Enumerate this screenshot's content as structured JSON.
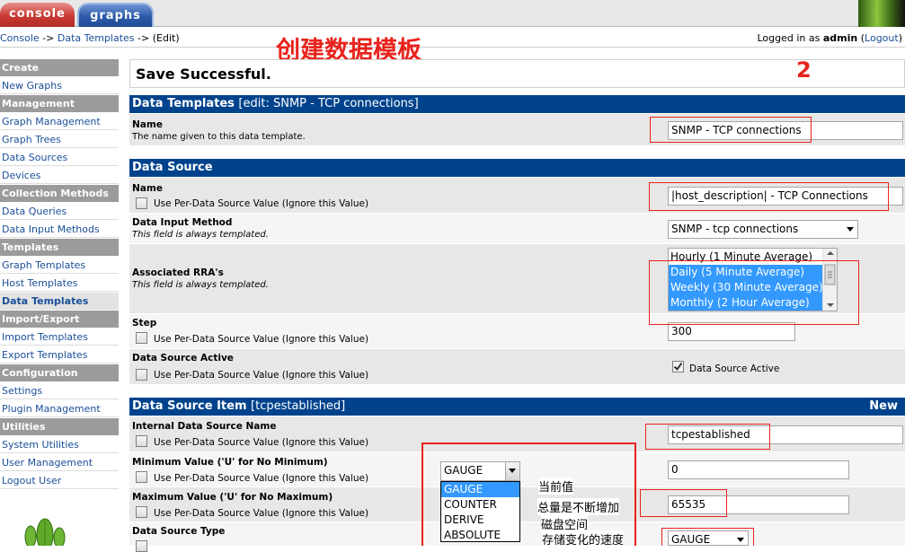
{
  "tabs": {
    "console": "console",
    "graphs": "graphs"
  },
  "breadcrumb": {
    "console": "Console",
    "sep1": "->",
    "data_templates": "Data Templates",
    "sep2": "->",
    "edit": "(Edit)"
  },
  "login": {
    "prefix": "Logged in as",
    "user": "admin",
    "logout": "Logout"
  },
  "annotations": {
    "heading": "创建数据模板",
    "step_number": "2",
    "gauge_note": "当前值",
    "counter_note": "总量是不断增加",
    "disk_note": "磁盘空间",
    "derive_note": "存储变化的速度"
  },
  "sidebar": {
    "create": "Create",
    "new_graphs": "New Graphs",
    "management": "Management",
    "graph_management": "Graph Management",
    "graph_trees": "Graph Trees",
    "data_sources": "Data Sources",
    "devices": "Devices",
    "collection_methods": "Collection Methods",
    "data_queries": "Data Queries",
    "data_input_methods": "Data Input Methods",
    "templates": "Templates",
    "graph_templates": "Graph Templates",
    "host_templates": "Host Templates",
    "data_templates": "Data Templates",
    "import_export": "Import/Export",
    "import_templates": "Import Templates",
    "export_templates": "Export Templates",
    "configuration": "Configuration",
    "settings": "Settings",
    "plugin_management": "Plugin Management",
    "utilities": "Utilities",
    "system_utilities": "System Utilities",
    "user_management": "User Management",
    "logout_user": "Logout User"
  },
  "message": "Save Successful.",
  "section_template": {
    "title": "Data Templates",
    "edit": "[edit: SNMP - TCP connections]"
  },
  "template_name": {
    "label": "Name",
    "desc": "The name given to this data template.",
    "value": "SNMP - TCP connections"
  },
  "section_source": {
    "title": "Data Source"
  },
  "ds_name": {
    "label": "Name",
    "check_label": "Use Per-Data Source Value (Ignore this Value)",
    "value": "|host_description| - TCP Connections"
  },
  "ds_input": {
    "label": "Data Input Method",
    "desc": "This field is always templated.",
    "value": "SNMP - tcp connections"
  },
  "ds_rra": {
    "label": "Associated RRA's",
    "desc": "This field is always templated.",
    "options": [
      "Hourly (1 Minute Average)",
      "Daily (5 Minute Average)",
      "Weekly (30 Minute Average)",
      "Monthly (2 Hour Average)"
    ]
  },
  "ds_step": {
    "label": "Step",
    "check_label": "Use Per-Data Source Value (Ignore this Value)",
    "value": "300"
  },
  "ds_active": {
    "label": "Data Source Active",
    "check_label": "Use Per-Data Source Value (Ignore this Value)",
    "value_label": "Data Source Active"
  },
  "section_item": {
    "title": "Data Source Item",
    "item": "[tcpestablished]",
    "new": "New"
  },
  "item_name": {
    "label": "Internal Data Source Name",
    "check_label": "Use Per-Data Source Value (Ignore this Value)",
    "value": "tcpestablished"
  },
  "item_min": {
    "label": "Minimum Value ('U' for No Minimum)",
    "check_label": "Use Per-Data Source Value (Ignore this Value)",
    "value": "0"
  },
  "item_max": {
    "label": "Maximum Value ('U' for No Maximum)",
    "check_label": "Use Per-Data Source Value (Ignore this Value)",
    "value": "65535"
  },
  "item_type": {
    "label": "Data Source Type",
    "selected": "GAUGE",
    "open_selected": "GAUGE",
    "options": [
      "GAUGE",
      "COUNTER",
      "DERIVE",
      "ABSOLUTE"
    ]
  }
}
